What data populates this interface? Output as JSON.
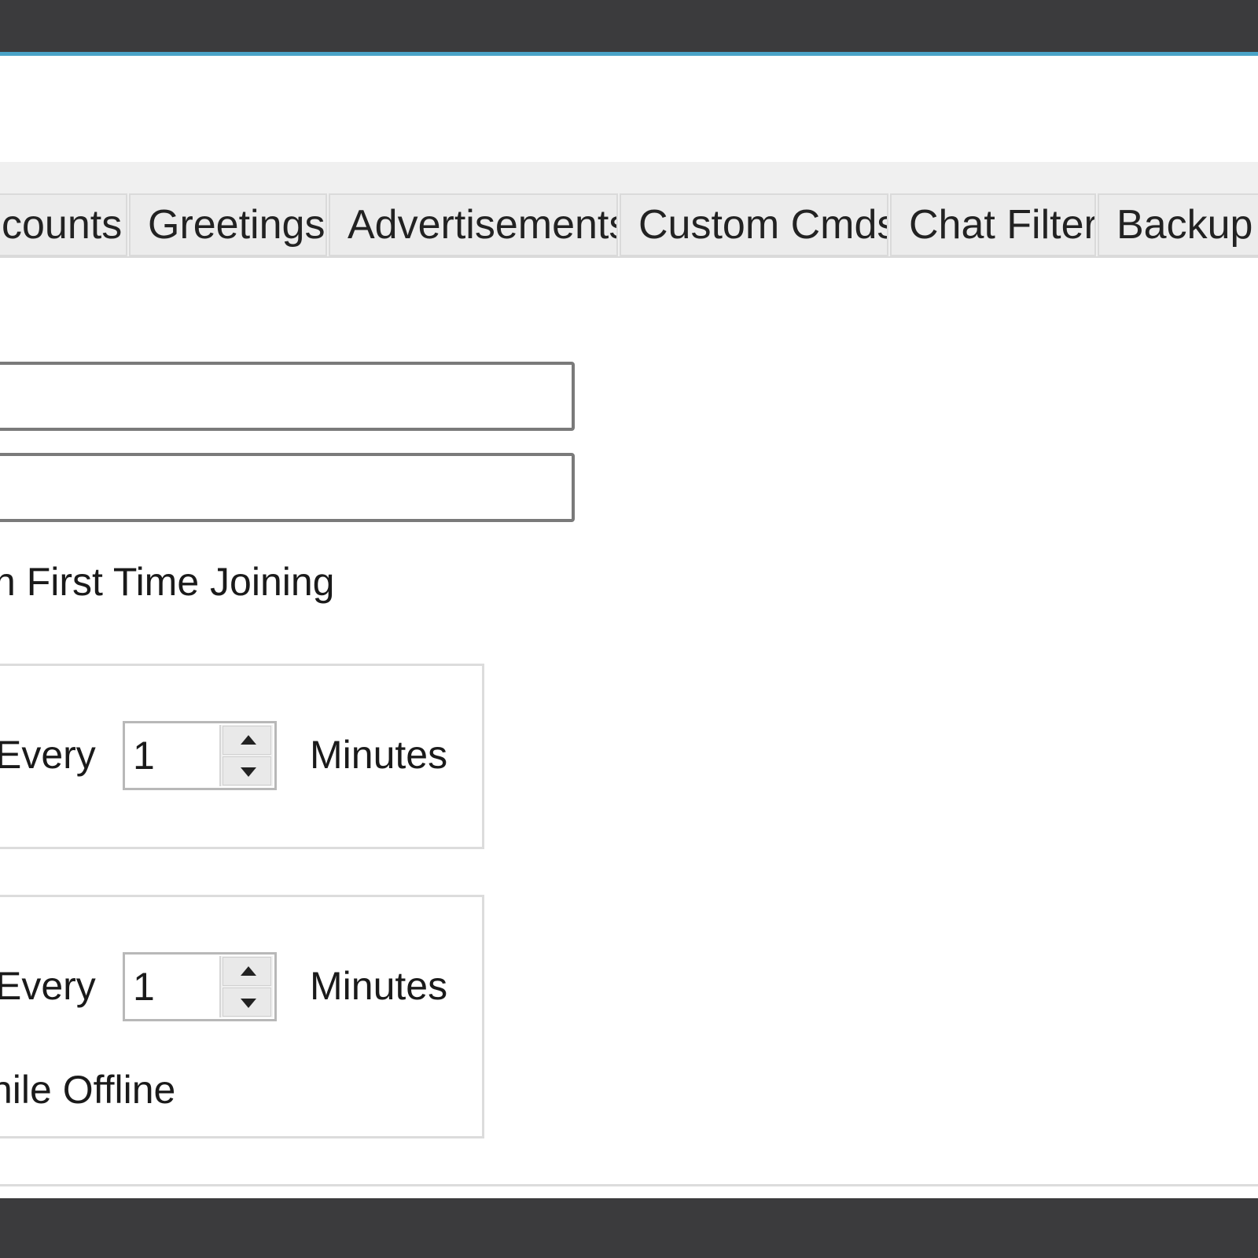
{
  "tabs": [
    {
      "label": "counts"
    },
    {
      "label": "Greetings"
    },
    {
      "label": "Advertisements"
    },
    {
      "label": "Custom Cmds"
    },
    {
      "label": "Chat Filter"
    },
    {
      "label": "Backup"
    }
  ],
  "greetings": {
    "first_join_label": "n First Time Joining"
  },
  "group1": {
    "every_label": "Every",
    "interval_value": "1",
    "minutes_label": "Minutes"
  },
  "group2": {
    "every_label": "Every",
    "interval_value": "1",
    "minutes_label": "Minutes",
    "offline_label": "hile Offline"
  }
}
